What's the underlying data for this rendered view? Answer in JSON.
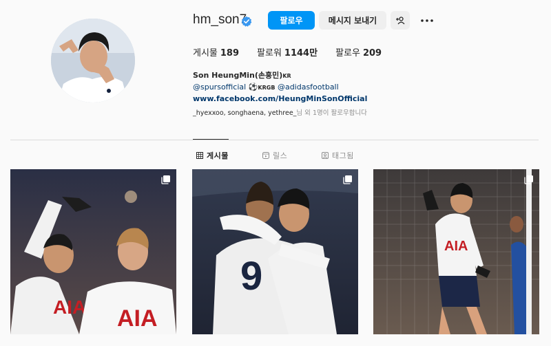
{
  "profile": {
    "username": "hm_son7",
    "follow_label": "팔로우",
    "message_label": "메시지 보내기",
    "stats": [
      {
        "label": "게시물",
        "value": "189"
      },
      {
        "label": "팔로워",
        "value": "1144만"
      },
      {
        "label": "팔로우",
        "value": "209"
      }
    ],
    "bio": {
      "name": "Son HeungMin(손흥민)",
      "name_suffix": "KR",
      "line2_tag1": "@spursofficial",
      "line2_mid": "KRGB",
      "line2_tag2": "@adidasfootball",
      "website": "www.facebook.com/HeungMinSonOfficial"
    },
    "followed_by_names": "_hyexxoo, songhaena, yethree_",
    "followed_by_suffix": "님 외 1명이 팔로우합니다"
  },
  "tabs": [
    {
      "label": "게시물",
      "icon": "grid-icon",
      "active": true
    },
    {
      "label": "릴스",
      "icon": "reels-icon",
      "active": false
    },
    {
      "label": "태그됨",
      "icon": "tagged-icon",
      "active": false
    }
  ],
  "colors": {
    "accent": "#0095f6",
    "link": "#00376b",
    "verified": "#3897f0"
  },
  "posts": [
    {
      "name": "post-1",
      "icon": "multi-post-icon"
    },
    {
      "name": "post-2",
      "icon": "multi-post-icon"
    },
    {
      "name": "post-3",
      "icon": "multi-post-icon"
    }
  ]
}
